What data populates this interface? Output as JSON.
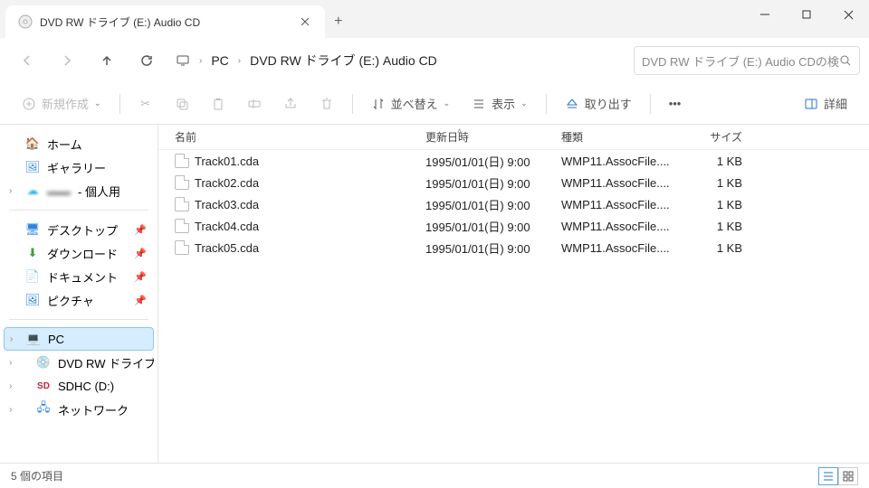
{
  "tab": {
    "title": "DVD RW ドライブ (E:) Audio CD"
  },
  "breadcrumbs": {
    "pc": "PC",
    "current": "DVD RW ドライブ (E:) Audio CD"
  },
  "search": {
    "placeholder": "DVD RW ドライブ (E:) Audio CDの検"
  },
  "toolbar": {
    "new": "新規作成",
    "sort": "並べ替え",
    "view": "表示",
    "eject": "取り出す",
    "details": "詳細"
  },
  "sidebar": {
    "home": "ホーム",
    "gallery": "ギャラリー",
    "personal": " - 個人用",
    "desktop": "デスクトップ",
    "downloads": "ダウンロード",
    "documents": "ドキュメント",
    "pictures": "ピクチャ",
    "pc": "PC",
    "dvd": "DVD RW ドライブ (E:) A",
    "sdhc": "SDHC (D:)",
    "network": "ネットワーク"
  },
  "columns": {
    "name": "名前",
    "date": "更新日時",
    "type": "種類",
    "size": "サイズ"
  },
  "files": [
    {
      "name": "Track01.cda",
      "date": "1995/01/01(日) 9:00",
      "type": "WMP11.AssocFile....",
      "size": "1 KB"
    },
    {
      "name": "Track02.cda",
      "date": "1995/01/01(日) 9:00",
      "type": "WMP11.AssocFile....",
      "size": "1 KB"
    },
    {
      "name": "Track03.cda",
      "date": "1995/01/01(日) 9:00",
      "type": "WMP11.AssocFile....",
      "size": "1 KB"
    },
    {
      "name": "Track04.cda",
      "date": "1995/01/01(日) 9:00",
      "type": "WMP11.AssocFile....",
      "size": "1 KB"
    },
    {
      "name": "Track05.cda",
      "date": "1995/01/01(日) 9:00",
      "type": "WMP11.AssocFile....",
      "size": "1 KB"
    }
  ],
  "status": {
    "text": "5 個の項目"
  }
}
